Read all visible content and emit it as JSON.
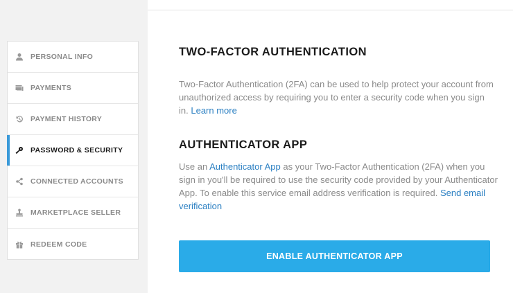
{
  "sidebar": {
    "items": [
      {
        "label": "PERSONAL INFO",
        "icon": "user-icon"
      },
      {
        "label": "PAYMENTS",
        "icon": "payment-card-icon"
      },
      {
        "label": "PAYMENT HISTORY",
        "icon": "history-icon"
      },
      {
        "label": "PASSWORD & SECURITY",
        "icon": "key-icon",
        "active": true
      },
      {
        "label": "CONNECTED ACCOUNTS",
        "icon": "share-icon"
      },
      {
        "label": "MARKETPLACE SELLER",
        "icon": "stamp-icon"
      },
      {
        "label": "REDEEM CODE",
        "icon": "gift-icon"
      }
    ]
  },
  "main": {
    "two_factor": {
      "title": "TWO-FACTOR AUTHENTICATION",
      "text": "Two-Factor Authentication (2FA) can be used to help protect your account from unauthorized access by requiring you to enter a security code when you sign in.",
      "learn_more": "Learn more"
    },
    "authenticator": {
      "title": "AUTHENTICATOR APP",
      "text_before": "Use an",
      "app_link": "Authenticator App",
      "text_after": "as your Two-Factor Authentication (2FA) when you sign in you'll be required to use the security code provided by your Authenticator App. To enable this service email address verification is required.",
      "verify_link": "Send email verification"
    },
    "enable_button": "ENABLE AUTHENTICATOR APP"
  },
  "colors": {
    "accent": "#3a9ad9",
    "button": "#2aabe8",
    "link": "#2a7fc2",
    "text_muted": "#8a8a8a"
  }
}
